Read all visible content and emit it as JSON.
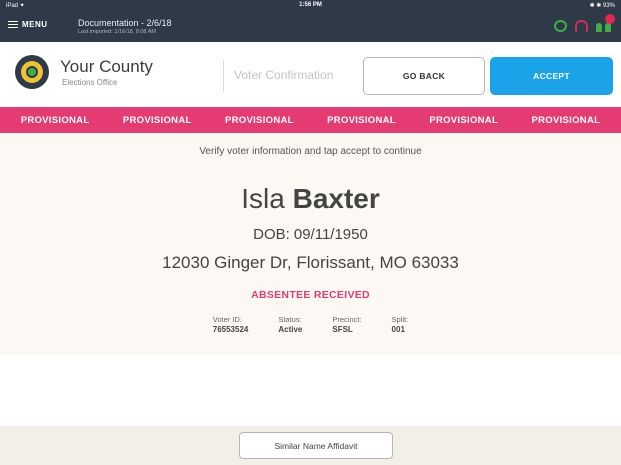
{
  "status_bar": {
    "carrier": "iPad ✦",
    "time": "1:56 PM",
    "battery": "✱ ✱ 93%"
  },
  "topbar": {
    "menu_label": "MENU",
    "doc_title": "Documentation - 2/6/18",
    "doc_subtitle": "Last imported: 1/16/18, 8:08 AM",
    "icons": [
      "sync-icon",
      "headset-icon",
      "users-icon"
    ],
    "notification_color": "#e2264f"
  },
  "header": {
    "county_name": "Your County",
    "county_subtitle": "Elections Office",
    "screen_title": "Voter Confirmation",
    "go_back_label": "GO BACK",
    "accept_label": "ACCEPT"
  },
  "provisional_band": {
    "items": [
      "PROVISIONAL",
      "PROVISIONAL",
      "PROVISIONAL",
      "PROVISIONAL",
      "PROVISIONAL",
      "PROVISIONAL"
    ],
    "color": "#e43b72"
  },
  "voter": {
    "instruction": "Verify voter information and tap accept to continue",
    "first_name": "Isla",
    "last_name": "Baxter",
    "dob_label": "DOB:",
    "dob": "09/11/1950",
    "address": "12030 Ginger Dr, Florissant, MO 63033",
    "absentee_status": "ABSENTEE RECEIVED",
    "details": [
      {
        "label": "Voter ID:",
        "value": "76553524"
      },
      {
        "label": "Status:",
        "value": "Active"
      },
      {
        "label": "Precinct:",
        "value": "SFSL"
      },
      {
        "label": "Split:",
        "value": "001"
      }
    ]
  },
  "footer": {
    "affidavit_label": "Similar Name Affidavit"
  },
  "colors": {
    "topbar": "#2e3a48",
    "accent_blue": "#1aa3e8",
    "accent_pink": "#e43b72",
    "green": "#3fae49"
  }
}
